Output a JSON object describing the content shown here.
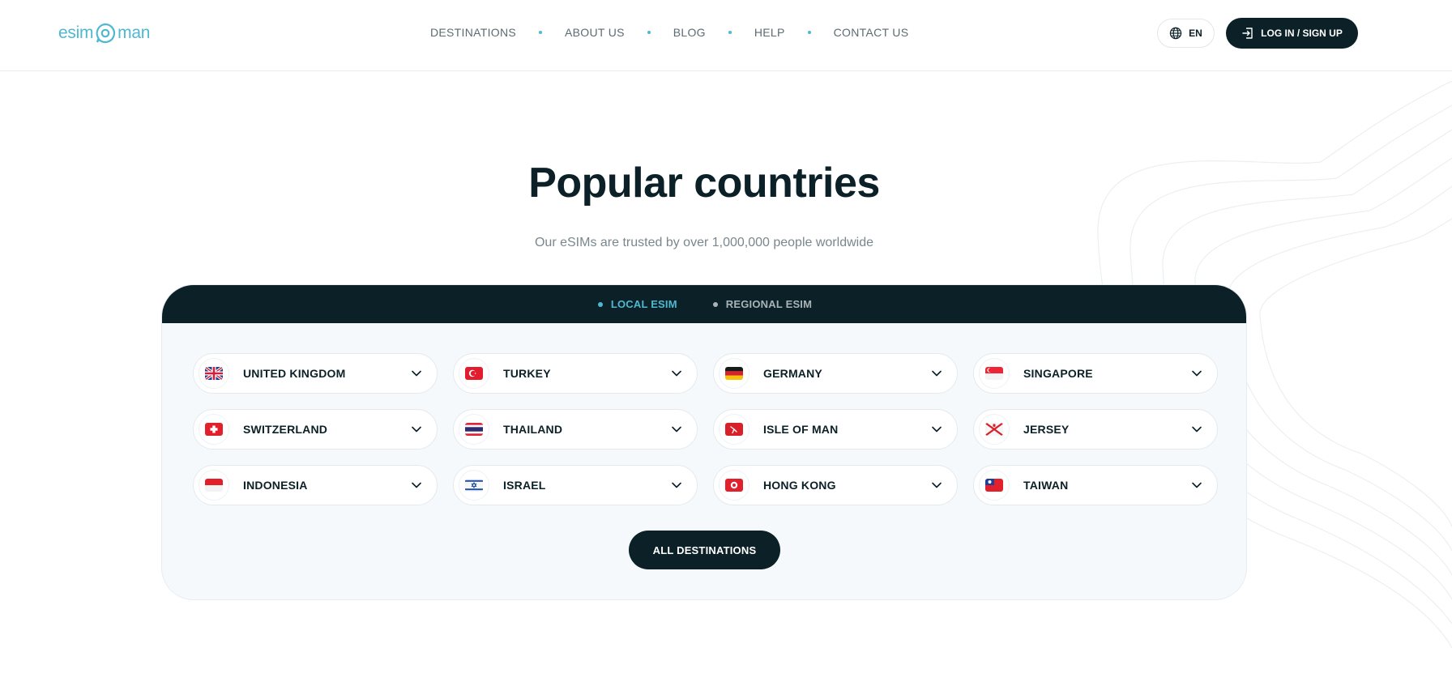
{
  "header": {
    "logo_left": "esim",
    "logo_right": "man",
    "nav": [
      {
        "label": "DESTINATIONS"
      },
      {
        "label": "ABOUT US"
      },
      {
        "label": "BLOG"
      },
      {
        "label": "HELP"
      },
      {
        "label": "CONTACT US"
      }
    ],
    "lang_label": "EN",
    "login_label": "LOG IN / SIGN UP"
  },
  "main": {
    "title": "Popular countries",
    "subtitle": "Our eSIMs are trusted by over 1,000,000 people worldwide",
    "tabs": [
      {
        "label": "LOCAL ESIM",
        "active": true
      },
      {
        "label": "REGIONAL ESIM",
        "active": false
      }
    ],
    "countries": [
      {
        "name": "UNITED KINGDOM",
        "flag": "gb"
      },
      {
        "name": "TURKEY",
        "flag": "tr"
      },
      {
        "name": "GERMANY",
        "flag": "de"
      },
      {
        "name": "SINGAPORE",
        "flag": "sg"
      },
      {
        "name": "SWITZERLAND",
        "flag": "ch"
      },
      {
        "name": "THAILAND",
        "flag": "th"
      },
      {
        "name": "ISLE OF MAN",
        "flag": "im"
      },
      {
        "name": "JERSEY",
        "flag": "je"
      },
      {
        "name": "INDONESIA",
        "flag": "id"
      },
      {
        "name": "ISRAEL",
        "flag": "il"
      },
      {
        "name": "HONG KONG",
        "flag": "hk"
      },
      {
        "name": "TAIWAN",
        "flag": "tw"
      }
    ],
    "all_destinations_label": "ALL DESTINATIONS"
  },
  "colors": {
    "brand_accent": "#4fb8d0",
    "dark": "#0b2027",
    "panel_bg": "#f5f9fc"
  }
}
